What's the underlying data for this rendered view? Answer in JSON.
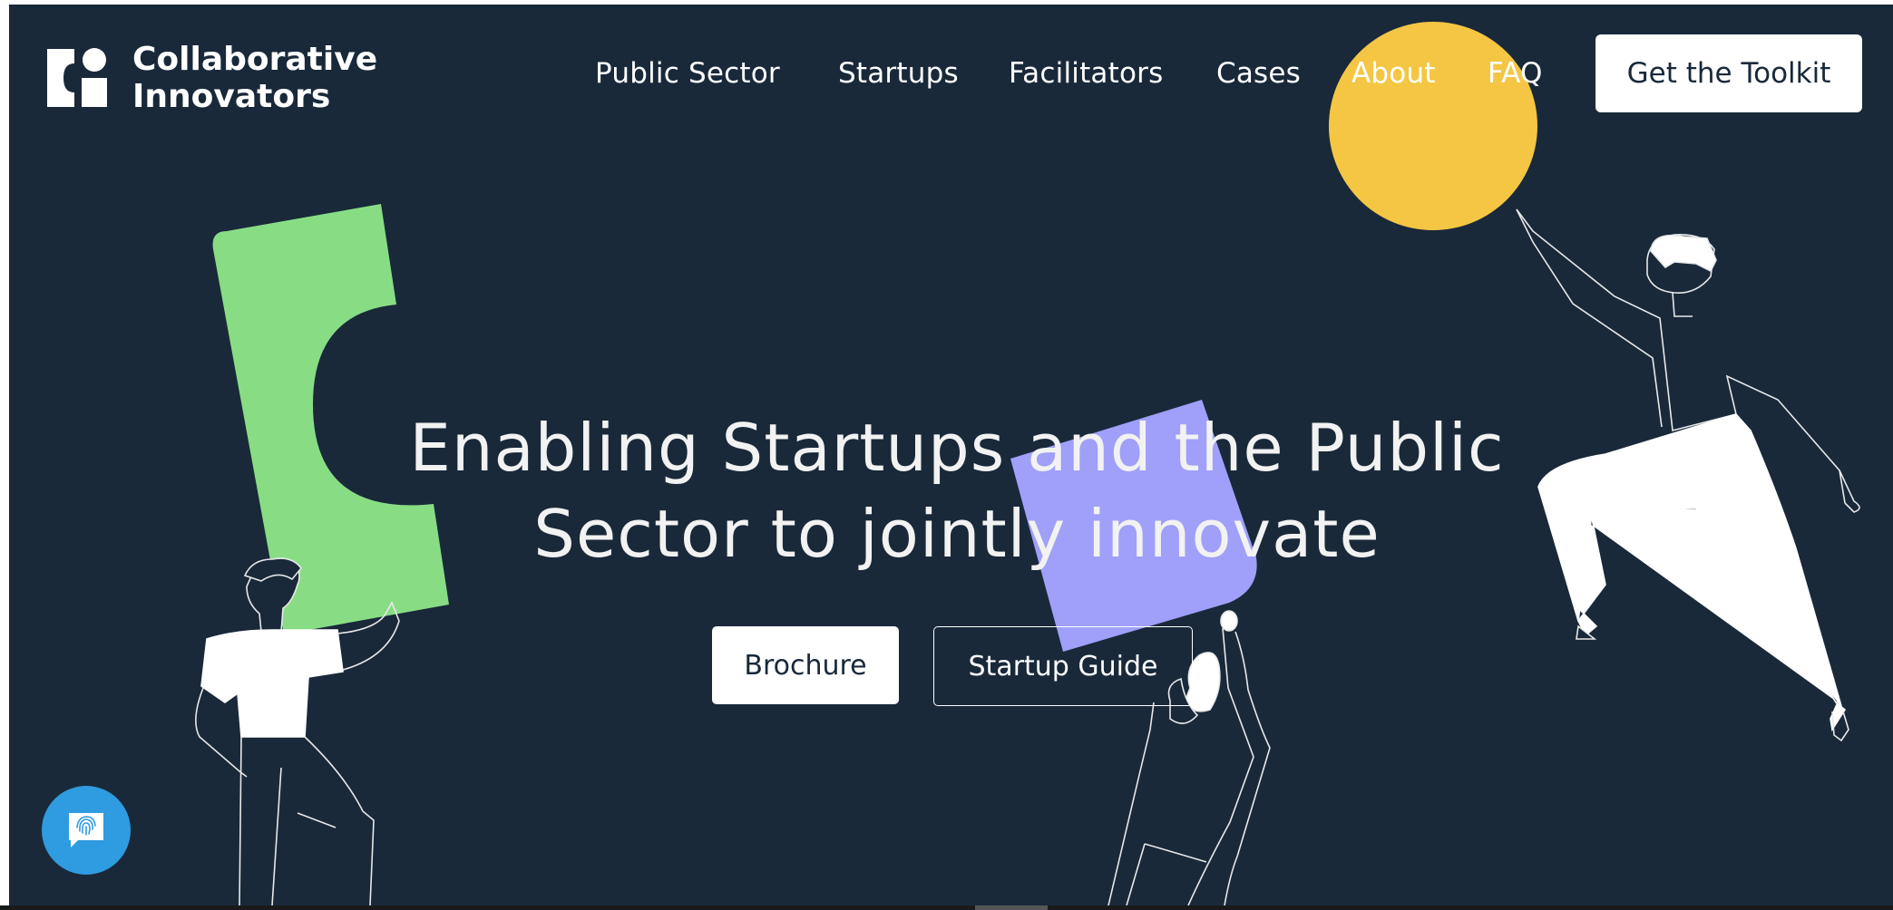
{
  "brand": {
    "name_line1": "Collaborative",
    "name_line2": "Innovators",
    "logo_icon": "ci-logo-icon"
  },
  "nav": {
    "items": [
      {
        "label": "Public Sector"
      },
      {
        "label": "Startups"
      },
      {
        "label": "Facilitators"
      },
      {
        "label": "Cases"
      },
      {
        "label": "About"
      },
      {
        "label": "FAQ"
      }
    ],
    "cta_label": "Get the Toolkit"
  },
  "hero": {
    "title_line1": "Enabling Startups and the Public",
    "title_line2": "Sector to jointly innovate",
    "primary_button": "Brochure",
    "secondary_button": "Startup Guide"
  },
  "chat": {
    "icon": "fingerprint-chat-icon"
  },
  "colors": {
    "background": "#19293a",
    "accent_yellow": "#f4c644",
    "accent_green": "#88dd84",
    "accent_purple": "#a09ffa",
    "chat_blue": "#2f9be0"
  }
}
